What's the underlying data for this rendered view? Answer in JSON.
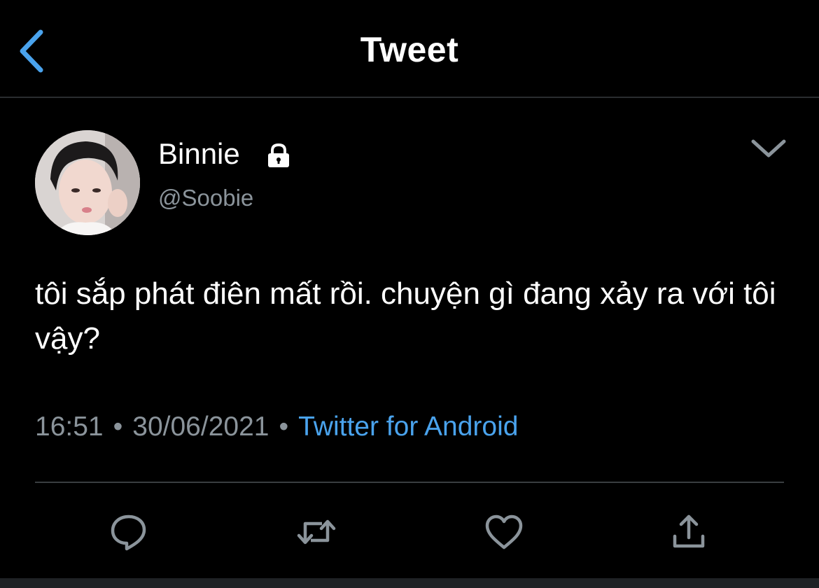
{
  "header": {
    "title": "Tweet",
    "back_icon": "chevron-left-icon",
    "accent_color": "#4aa3ed"
  },
  "tweet": {
    "author": {
      "display_name": "Binnie",
      "handle": "@Soobie",
      "protected_icon": "lock-icon"
    },
    "text": "tôi sắp phát điên mất rồi. chuyện gì đang xảy ra với tôi vậy?",
    "time": "16:51",
    "date": "30/06/2021",
    "separator": "•",
    "source": "Twitter for Android"
  },
  "actions": [
    {
      "icon": "reply-icon"
    },
    {
      "icon": "retweet-icon"
    },
    {
      "icon": "like-icon"
    },
    {
      "icon": "share-icon"
    }
  ]
}
